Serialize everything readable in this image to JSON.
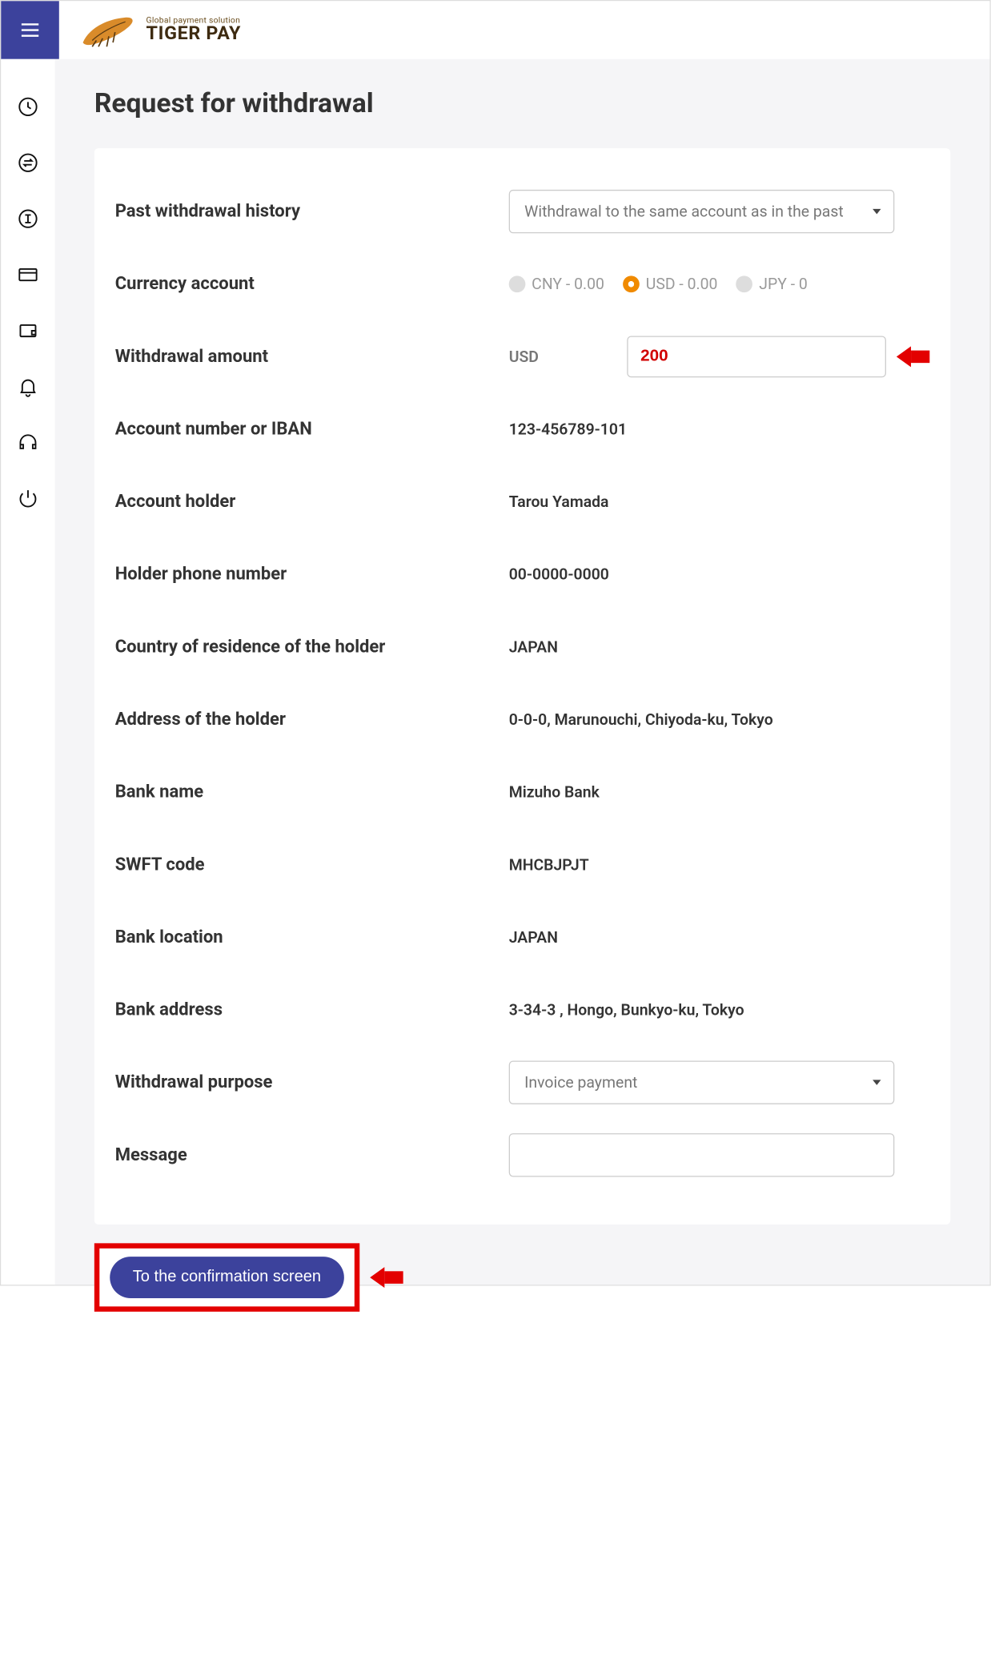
{
  "brand": {
    "small": "Global payment solution",
    "big": "TIGER PAY"
  },
  "page_title": "Request for withdrawal",
  "form": {
    "history_label": "Past withdrawal history",
    "history_select": "Withdrawal to the same account as in the past",
    "currency_label": "Currency account",
    "currencies": {
      "cny": "CNY - 0.00",
      "usd": "USD - 0.00",
      "jpy": "JPY - 0"
    },
    "amount_label": "Withdrawal amount",
    "amount_unit": "USD",
    "amount_value": "200",
    "account_number_label": "Account number or IBAN",
    "account_number_value": "123-456789-101",
    "account_holder_label": "Account holder",
    "account_holder_value": "Tarou  Yamada",
    "phone_label": "Holder phone number",
    "phone_value": "00-0000-0000",
    "country_label": "Country of residence of the holder",
    "country_value": "JAPAN",
    "address_label": "Address of the holder",
    "address_value": "0-0-0, Marunouchi, Chiyoda-ku, Tokyo",
    "bank_name_label": "Bank name",
    "bank_name_value": "Mizuho Bank",
    "swift_label": "SWFT code",
    "swift_value": "MHCBJPJT",
    "bank_location_label": "Bank location",
    "bank_location_value": "JAPAN",
    "bank_address_label": "Bank address",
    "bank_address_value": "3-34-3 , Hongo, Bunkyo-ku, Tokyo",
    "purpose_label": "Withdrawal purpose",
    "purpose_select": "Invoice payment",
    "message_label": "Message",
    "message_value": ""
  },
  "confirm_button": "To the confirmation screen"
}
